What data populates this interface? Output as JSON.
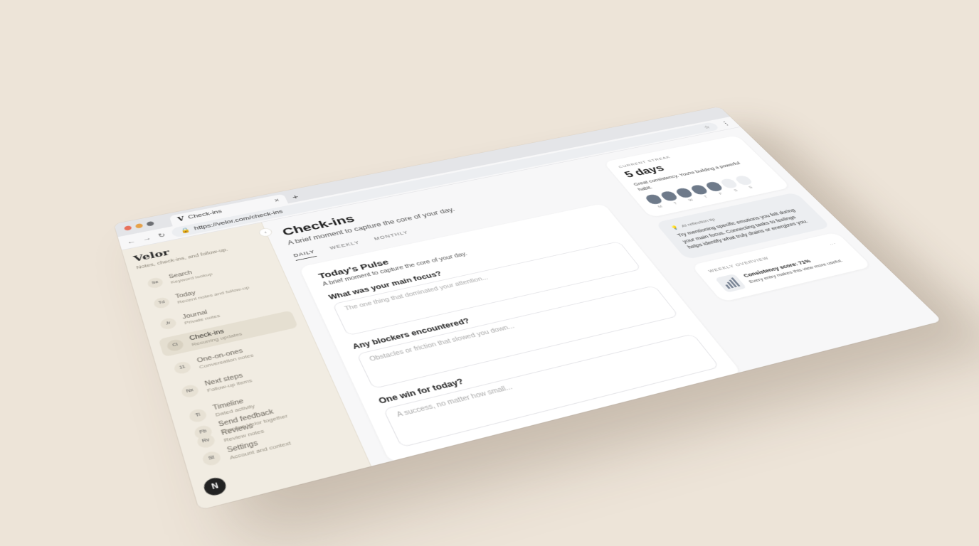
{
  "browser": {
    "tab_logo": "V",
    "tab_title": "Check-ins",
    "tab_close": "×",
    "new_tab": "+",
    "url": "https://velor.com/check-ins",
    "back": "←",
    "forward": "→",
    "reload": "↻",
    "menu": "⋮",
    "dot_colors": [
      "#e8705a",
      "#e6a24a",
      "#6d6f73"
    ]
  },
  "sidebar": {
    "brand": "Velor",
    "brand_sub": "Notes, check-ins, and follow-up.",
    "collapse": "‹",
    "items": [
      {
        "badge": "Se",
        "label": "Search",
        "sub": "Keyword lookup"
      },
      {
        "badge": "Td",
        "label": "Today",
        "sub": "Recent notes and follow-up"
      },
      {
        "badge": "Jr",
        "label": "Journal",
        "sub": "Private notes"
      },
      {
        "badge": "Ci",
        "label": "Check-ins",
        "sub": "Recurring updates"
      },
      {
        "badge": "11",
        "label": "One-on-ones",
        "sub": "Conversation notes"
      },
      {
        "badge": "Nx",
        "label": "Next steps",
        "sub": "Follow-up items"
      },
      {
        "badge": "Ti",
        "label": "Timeline",
        "sub": "Dated activity"
      },
      {
        "badge": "Rv",
        "label": "Reviews",
        "sub": "Review notes"
      }
    ],
    "bottom": [
      {
        "badge": "Fb",
        "label": "Send feedback",
        "sub": "Improve Velor together"
      },
      {
        "badge": "St",
        "label": "Settings",
        "sub": "Account and context"
      }
    ],
    "avatar": "N"
  },
  "main": {
    "title": "Check-ins",
    "subtitle": "A brief moment to capture the core of your day.",
    "tabs": [
      "DAILY",
      "WEEKLY",
      "MONTHLY"
    ],
    "pulse": {
      "title": "Today's Pulse",
      "subtitle": "A brief moment to capture the core of your day.",
      "questions": [
        {
          "label": "What was your main focus?",
          "placeholder": "The one thing that dominated your attention..."
        },
        {
          "label": "Any blockers encountered?",
          "placeholder": "Obstacles or friction that slowed you down..."
        },
        {
          "label": "One win for today?",
          "placeholder": "A success, no matter how small..."
        }
      ]
    }
  },
  "right": {
    "streak": {
      "label": "CURRENT STREAK",
      "value": "5 days",
      "text": "Great consistency. You're building a powerful habit.",
      "days": [
        {
          "letter": "M",
          "done": true
        },
        {
          "letter": "T",
          "done": true
        },
        {
          "letter": "W",
          "done": true
        },
        {
          "letter": "T",
          "done": true
        },
        {
          "letter": "F",
          "done": true
        },
        {
          "letter": "S",
          "done": false
        },
        {
          "letter": "S",
          "done": false
        }
      ]
    },
    "tip": {
      "label": "AI reflection tip",
      "icon": "💡",
      "text": "Try mentioning specific emotions you felt during your main focus. Connecting tasks to feelings helps identify what truly drains or energizes you."
    },
    "weekly": {
      "label": "WEEKLY OVERVIEW",
      "more": "...",
      "title": "Consistency score: 71%",
      "text": "Every entry makes this view more useful."
    }
  }
}
